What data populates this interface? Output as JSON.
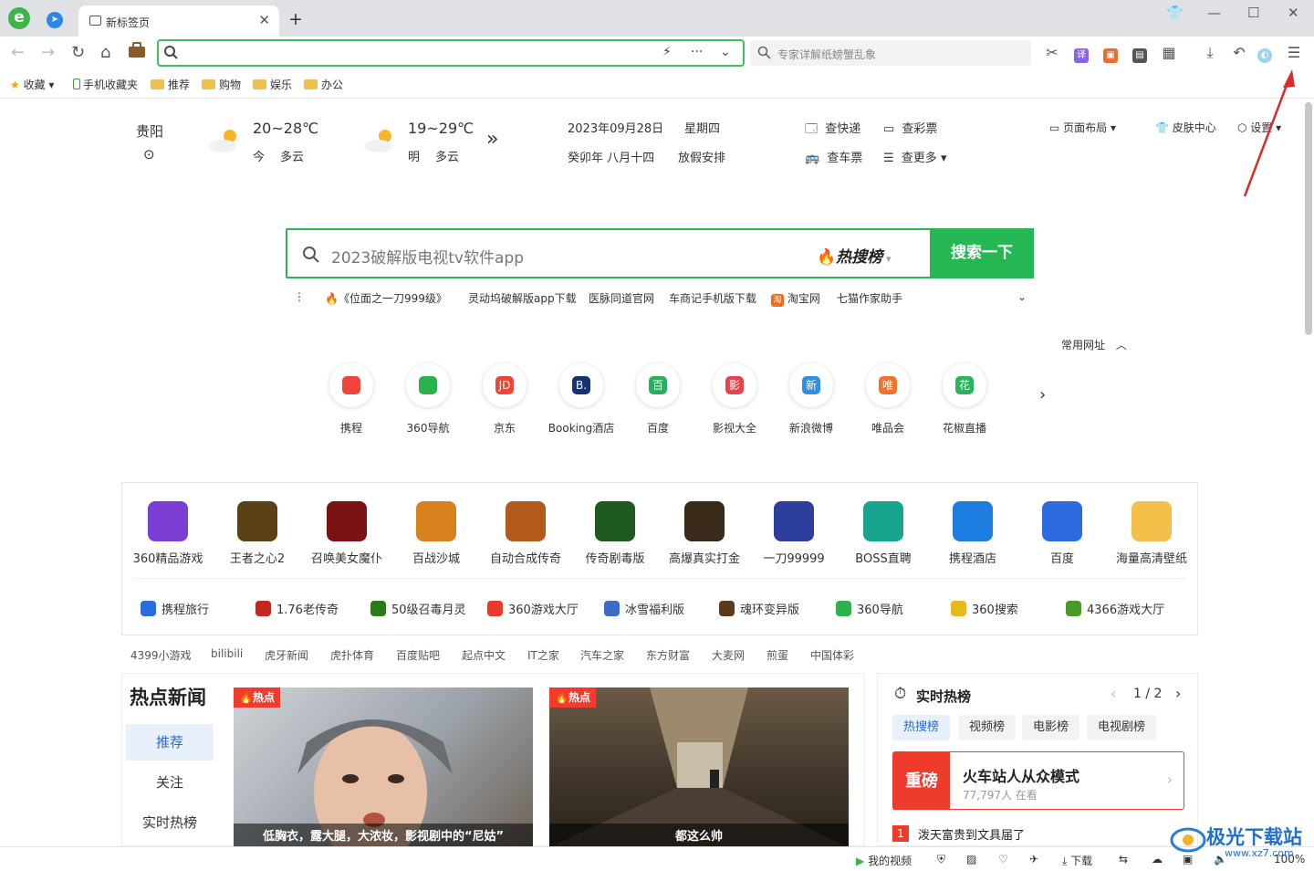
{
  "tabbar": {
    "tab_title": "新标签页",
    "new_tab": "+",
    "win": [
      "⌂",
      "—",
      "☐",
      "✕"
    ]
  },
  "toolbar": {
    "search_placeholder": "专家详解纸螃蟹乱象"
  },
  "bookmarks": {
    "items": [
      "收藏",
      "手机收藏夹",
      "推荐",
      "购物",
      "娱乐",
      "办公"
    ]
  },
  "header": {
    "city": "贵阳",
    "today_temp": "20~28℃",
    "today_day": "今",
    "today_cond": "多云",
    "tom_temp": "19~29℃",
    "tom_day": "明",
    "tom_cond": "多云",
    "more": "»",
    "date": "2023年09月28日",
    "weekday": "星期四",
    "lunar": "癸卯年 八月十四",
    "holiday": "放假安排",
    "tools": [
      "查快递",
      "查彩票",
      "查车票",
      "查更多"
    ],
    "layout": "页面布局",
    "skin": "皮肤中心",
    "settings": "设置"
  },
  "search": {
    "placeholder": "2023破解版电视tv软件app",
    "hot": "热搜榜",
    "button": "搜索一下"
  },
  "hotwords": [
    "《位面之一刀999级》",
    "灵动坞破解版app下载",
    "医脉同道官网",
    "车商记手机版下载",
    "淘宝网",
    "七猫作家助手"
  ],
  "sites_label": "常用网址",
  "sites": [
    {
      "label": "携程",
      "glyph": "",
      "color": "#f0433a"
    },
    {
      "label": "360导航",
      "glyph": "",
      "color": "#2cb24c"
    },
    {
      "label": "京东",
      "glyph": "JD",
      "color": "#f04535"
    },
    {
      "label": "Booking酒店",
      "glyph": "B.",
      "color": "#13346e"
    },
    {
      "label": "百度",
      "glyph": "百",
      "color": "#22b35a"
    },
    {
      "label": "影视大全",
      "glyph": "影",
      "color": "#e9424b"
    },
    {
      "label": "新浪微博",
      "glyph": "新",
      "color": "#2d8fe8"
    },
    {
      "label": "唯品会",
      "glyph": "唯",
      "color": "#f17228"
    },
    {
      "label": "花椒直播",
      "glyph": "花",
      "color": "#25b65a"
    }
  ],
  "games": [
    {
      "label": "360精品游戏",
      "color": "#7b3ed4"
    },
    {
      "label": "王者之心2",
      "color": "#5a4216"
    },
    {
      "label": "召唤美女魔仆",
      "color": "#7a1216"
    },
    {
      "label": "百战沙城",
      "color": "#d7811d"
    },
    {
      "label": "自动合成传奇",
      "color": "#b25a1a"
    },
    {
      "label": "传奇剧毒版",
      "color": "#1e5a20"
    },
    {
      "label": "高爆真实打金",
      "color": "#3a2a1a"
    },
    {
      "label": "一刀99999",
      "color": "#2d3e9c"
    },
    {
      "label": "BOSS直聘",
      "color": "#18a58d"
    },
    {
      "label": "携程酒店",
      "color": "#1c7ce0"
    },
    {
      "label": "百度",
      "color": "#2f6be0"
    },
    {
      "label": "海量高清壁纸",
      "color": "#f4c04a"
    }
  ],
  "game_links": [
    {
      "label": "携程旅行",
      "color": "#2b6de0"
    },
    {
      "label": "1.76老传奇",
      "color": "#c2281e"
    },
    {
      "label": "50级召毒月灵",
      "color": "#2a7a1c"
    },
    {
      "label": "360游戏大厅",
      "color": "#e53a2c"
    },
    {
      "label": "冰雪福利版",
      "color": "#3c6cc5"
    },
    {
      "label": "魂环变异版",
      "color": "#5a3a1a"
    },
    {
      "label": "360导航",
      "color": "#2cb24c"
    },
    {
      "label": "360搜索",
      "color": "#e9b81e"
    },
    {
      "label": "4366游戏大厅",
      "color": "#4a9a2a"
    }
  ],
  "links": [
    "4399小游戏",
    "bilibili",
    "虎牙新闻",
    "虎扑体育",
    "百度贴吧",
    "起点中文",
    "IT之家",
    "汽车之家",
    "东方财富",
    "大麦网",
    "煎蛋",
    "中国体彩"
  ],
  "news": {
    "title": "热点新闻",
    "nav": [
      "推荐",
      "关注",
      "实时热榜"
    ],
    "tag": "热点",
    "cap1": "低胸衣，露大腿，大浓妆，影视剧中的“尼姑”",
    "cap2": "都这么帅"
  },
  "rank": {
    "title": "实时热榜",
    "page": "1 / 2",
    "tabs": [
      "热搜榜",
      "视频榜",
      "电影榜",
      "电视剧榜"
    ],
    "badge": "重磅",
    "headline": "火车站人从众模式",
    "viewers": "77,797人 在看",
    "item1_no": "1",
    "item1": "泼天富贵到文具届了"
  },
  "status": {
    "video": "我的视频",
    "download": "下载",
    "zoom": "100%"
  },
  "watermark": {
    "name": "极光下载站",
    "url": "www.xz7.com"
  }
}
